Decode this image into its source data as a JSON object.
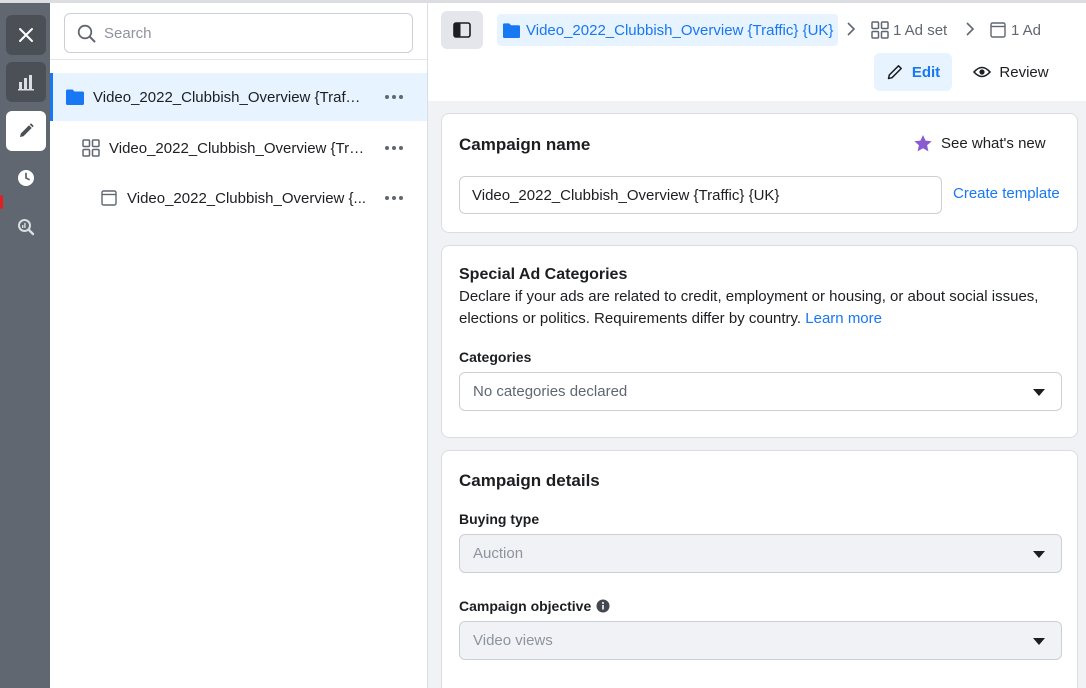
{
  "rail": {
    "close_icon": "close-icon",
    "items": [
      "reports-icon",
      "edit-icon",
      "history-icon",
      "search-data-icon"
    ]
  },
  "tree": {
    "search_placeholder": "Search",
    "items": [
      {
        "label": "Video_2022_Clubbish_Overview {Traffi...",
        "icon": "folder-icon"
      },
      {
        "label": "Video_2022_Clubbish_Overview {Tra...",
        "icon": "adset-grid-icon"
      },
      {
        "label": "Video_2022_Clubbish_Overview {...",
        "icon": "ad-icon"
      }
    ]
  },
  "breadcrumb": {
    "campaign": "Video_2022_Clubbish_Overview {Traffic} {UK}",
    "adset": "1 Ad set",
    "ad": "1 Ad"
  },
  "toolbar": {
    "edit_label": "Edit",
    "review_label": "Review"
  },
  "campaign_name": {
    "title": "Campaign name",
    "whats_new": "See what's new",
    "value": "Video_2022_Clubbish_Overview {Traffic} {UK}",
    "create_template": "Create template"
  },
  "special_ad": {
    "title": "Special Ad Categories",
    "description": "Declare if your ads are related to credit, employment or housing, or about social issues, elections or politics. Requirements differ by country.",
    "learn_more": "Learn more",
    "categories_label": "Categories",
    "categories_value": "No categories declared"
  },
  "campaign_details": {
    "title": "Campaign details",
    "buying_type_label": "Buying type",
    "buying_type_value": "Auction",
    "objective_label": "Campaign objective",
    "objective_value": "Video views"
  },
  "colors": {
    "accent": "#1877f2",
    "rail": "#606770",
    "selected_bg": "#e7f3ff",
    "star": "#8a5cd1"
  }
}
